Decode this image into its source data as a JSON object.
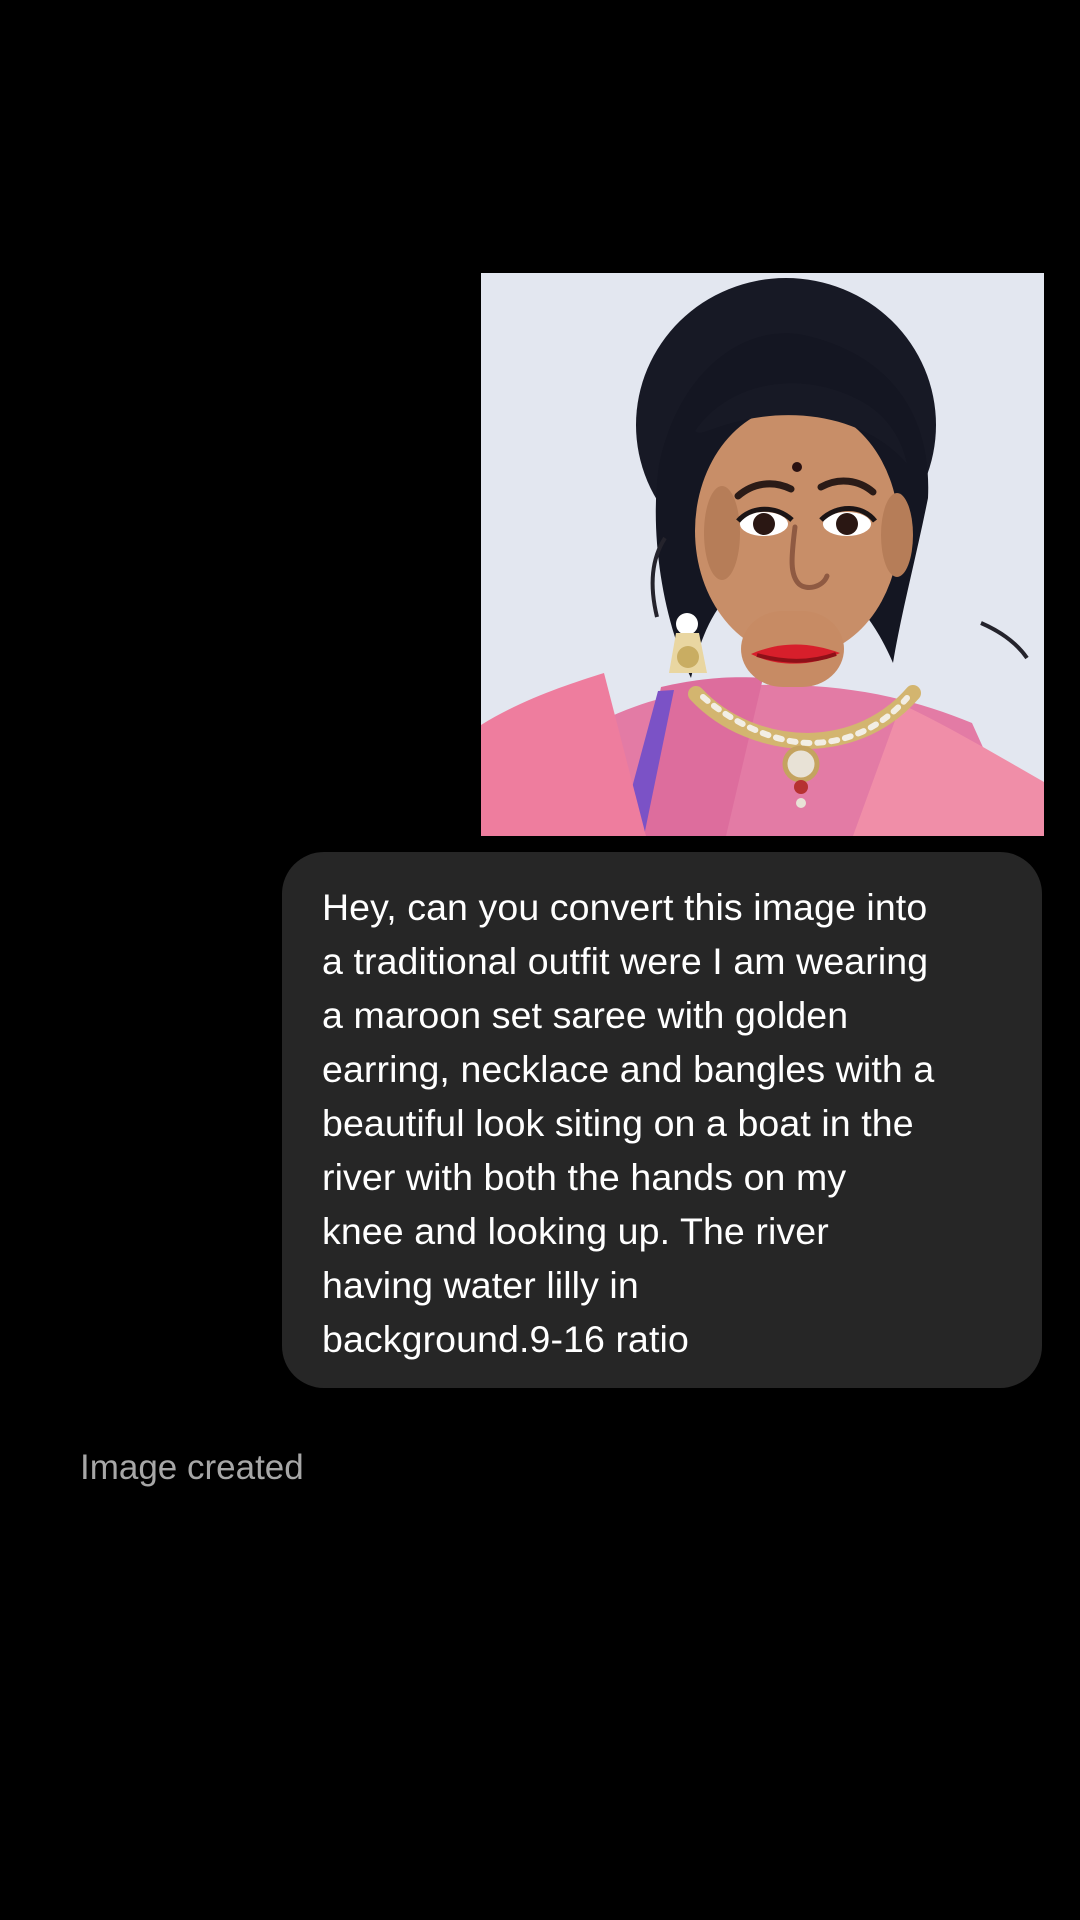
{
  "conversation": {
    "user_attachment": {
      "icon": "photo-attachment"
    },
    "user_message": {
      "text": "Hey, can you convert this image into\na traditional outfit were I am wearing\na maroon set saree with golden\nearring, necklace and bangles with a\nbeautiful look siting on a boat in the\nriver with both the hands on my\nknee and looking up. The river\nhaving water lilly in\nbackground.9-16 ratio"
    },
    "assistant_status": {
      "text": "Image created"
    }
  },
  "theme": {
    "background": "#000000",
    "bubble": "#262626",
    "message_text": "#ffffff",
    "status_text": "#a7a7a7"
  }
}
